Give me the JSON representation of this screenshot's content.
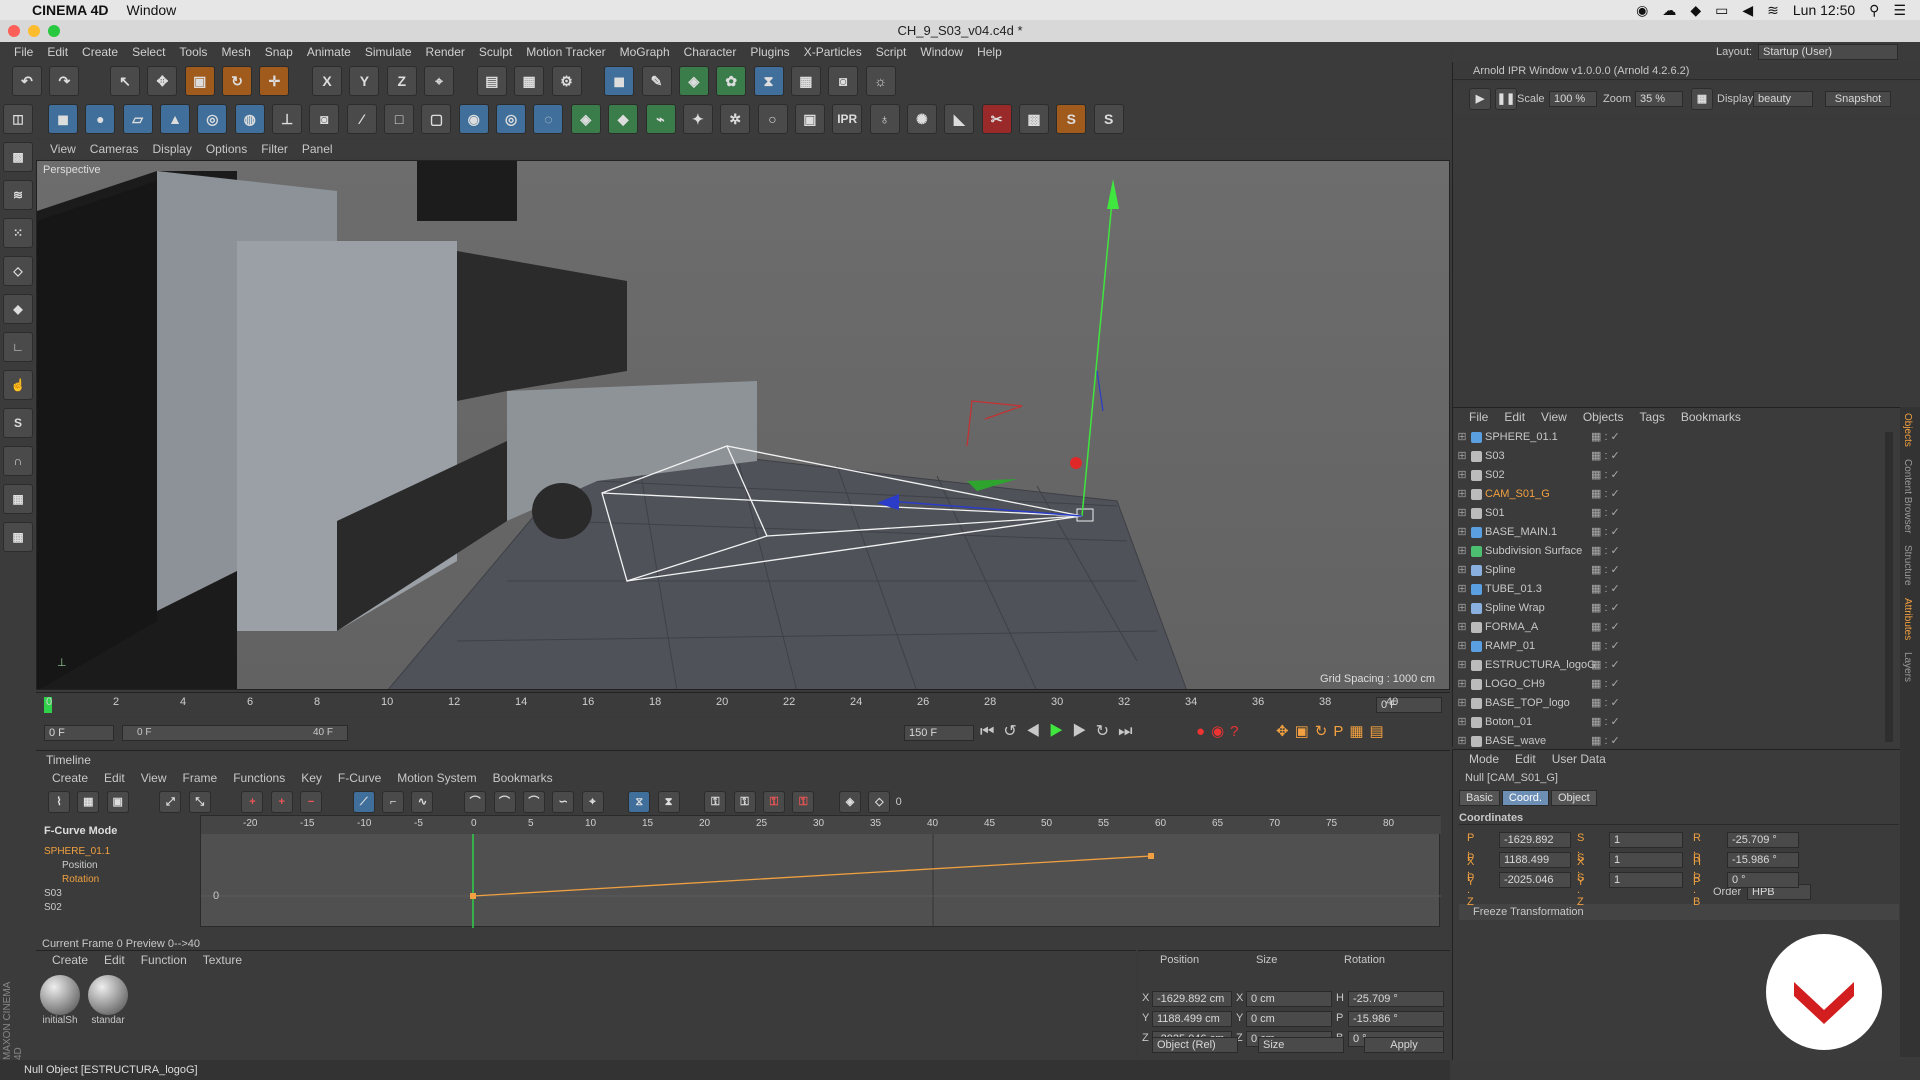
{
  "macbar": {
    "app": "CINEMA 4D",
    "menu": "Window",
    "clock": "Lun 12:50"
  },
  "window_title": "CH_9_S03_v04.c4d *",
  "menubar": [
    "File",
    "Edit",
    "Create",
    "Select",
    "Tools",
    "Mesh",
    "Snap",
    "Animate",
    "Simulate",
    "Render",
    "Sculpt",
    "Motion Tracker",
    "MoGraph",
    "Character",
    "Plugins",
    "X-Particles",
    "Script",
    "Window",
    "Help"
  ],
  "layout": {
    "label": "Layout:",
    "value": "Startup (User)"
  },
  "toolbar_letters": {
    "x": "X",
    "y": "Y",
    "z": "Z",
    "ipr": "IPR"
  },
  "viewport": {
    "menu": [
      "View",
      "Cameras",
      "Display",
      "Options",
      "Filter",
      "Panel"
    ],
    "label": "Perspective",
    "grid_spacing": "Grid Spacing : 1000 cm"
  },
  "ruler": {
    "ticks": [
      "0",
      "2",
      "4",
      "6",
      "8",
      "10",
      "12",
      "14",
      "16",
      "18",
      "20",
      "22",
      "24",
      "26",
      "28",
      "30",
      "32",
      "34",
      "36",
      "38",
      "40"
    ],
    "current": "0 F"
  },
  "timecontrols": {
    "start": "0 F",
    "range_start": "0 F",
    "range_end": "40 F",
    "end": "150 F"
  },
  "timeline": {
    "title": "Timeline",
    "menu": [
      "Create",
      "Edit",
      "View",
      "Frame",
      "Functions",
      "Key",
      "F-Curve",
      "Motion System",
      "Bookmarks"
    ],
    "mode": "F-Curve Mode",
    "keyframe_count": "0",
    "ticks": [
      "-20",
      "-15",
      "-10",
      "-5",
      "0",
      "5",
      "10",
      "15",
      "20",
      "25",
      "30",
      "35",
      "40",
      "45",
      "50",
      "55",
      "60",
      "65",
      "70",
      "75",
      "80"
    ],
    "tracks": [
      {
        "name": "SPHERE_01.1"
      },
      {
        "name": "Position"
      },
      {
        "name": "Rotation"
      },
      {
        "name": "S03"
      },
      {
        "name": "S02"
      }
    ],
    "zero_label": "0",
    "status": "Current Frame  0  Preview  0-->40"
  },
  "materials": {
    "menu": [
      "Create",
      "Edit",
      "Function",
      "Texture"
    ],
    "items": [
      {
        "name": "initialSh"
      },
      {
        "name": "standar"
      }
    ]
  },
  "coords": {
    "headers": [
      "Position",
      "Size",
      "Rotation"
    ],
    "rows": [
      {
        "axis": "X",
        "pos": "-1629.892 cm",
        "size_axis": "X",
        "size": "0 cm",
        "rot_axis": "H",
        "rot": "-25.709 °"
      },
      {
        "axis": "Y",
        "pos": "1188.499 cm",
        "size_axis": "Y",
        "size": "0 cm",
        "rot_axis": "P",
        "rot": "-15.986 °"
      },
      {
        "axis": "Z",
        "pos": "-2025.046 cm",
        "size_axis": "Z",
        "size": "0 cm",
        "rot_axis": "B",
        "rot": "0 °"
      }
    ],
    "mode": "Object (Rel)",
    "size_mode": "Size",
    "apply": "Apply"
  },
  "statusbar": "Null Object [ESTRUCTURA_logoG]",
  "ipr": {
    "title": "Arnold IPR Window v1.0.0.0 (Arnold 4.2.6.2)",
    "scale_label": "Scale",
    "scale": "100 %",
    "zoom_label": "Zoom",
    "zoom": "35 %",
    "display_label": "Display",
    "display": "beauty",
    "snapshot": "Snapshot"
  },
  "objects": {
    "menu": [
      "File",
      "Edit",
      "View",
      "Objects",
      "Tags",
      "Bookmarks"
    ],
    "items": [
      {
        "name": "SPHERE_01.1",
        "color": "#5aa0e0"
      },
      {
        "name": "S03",
        "color": "#bbbbbb"
      },
      {
        "name": "S02",
        "color": "#bbbbbb"
      },
      {
        "name": "CAM_S01_G",
        "color": "#bbbbbb"
      },
      {
        "name": "S01",
        "color": "#bbbbbb"
      },
      {
        "name": "BASE_MAIN.1",
        "color": "#5aa0e0"
      },
      {
        "name": "Subdivision Surface",
        "color": "#4cc070"
      },
      {
        "name": "Spline",
        "color": "#8ab0e0"
      },
      {
        "name": "TUBE_01.3",
        "color": "#5aa0e0"
      },
      {
        "name": "Spline Wrap",
        "color": "#8ab0e0"
      },
      {
        "name": "FORMA_A",
        "color": "#bbbbbb"
      },
      {
        "name": "RAMP_01",
        "color": "#5aa0e0"
      },
      {
        "name": "ESTRUCTURA_logoG",
        "color": "#bbbbbb"
      },
      {
        "name": "LOGO_CH9",
        "color": "#bbbbbb"
      },
      {
        "name": "BASE_TOP_logo",
        "color": "#bbbbbb"
      },
      {
        "name": "Boton_01",
        "color": "#bbbbbb"
      },
      {
        "name": "BASE_wave",
        "color": "#bbbbbb"
      }
    ]
  },
  "attributes": {
    "menu": [
      "Mode",
      "Edit",
      "User Data"
    ],
    "object": "Null [CAM_S01_G]",
    "tabs": [
      "Basic",
      "Coord.",
      "Object"
    ],
    "section": "Coordinates",
    "rows": [
      {
        "p": "P . X",
        "pv": "-1629.892",
        "s": "S . X",
        "sv": "1",
        "r": "R . H",
        "rv": "-25.709 °"
      },
      {
        "p": "P . Y",
        "pv": "1188.499",
        "s": "S . Y",
        "sv": "1",
        "r": "R . P",
        "rv": "-15.986 °"
      },
      {
        "p": "P . Z",
        "pv": "-2025.046",
        "s": "S . Z",
        "sv": "1",
        "r": "R . B",
        "rv": "0 °"
      }
    ],
    "order_label": "Order",
    "order": "HPB",
    "freeze": "Freeze Transformation"
  },
  "side_tabs": [
    "Objects",
    "Content Browser",
    "Structure",
    "Attributes",
    "Layers"
  ],
  "maxon": "MAXON CINEMA 4D"
}
